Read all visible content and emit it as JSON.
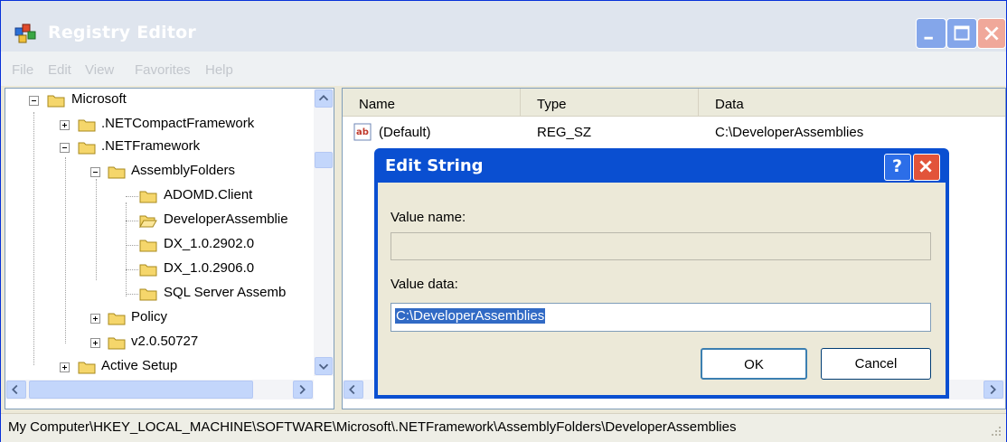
{
  "window": {
    "title": "Registry Editor"
  },
  "menu": [
    "File",
    "Edit",
    "View",
    "Favorites",
    "Help"
  ],
  "tree": [
    {
      "label": "Microsoft",
      "expanded": true
    },
    {
      "label": ".NETCompactFramework",
      "expanded": false
    },
    {
      "label": ".NETFramework",
      "expanded": true
    },
    {
      "label": "AssemblyFolders",
      "expanded": true
    },
    {
      "label": "ADOMD.Client"
    },
    {
      "label": "DeveloperAssemblie",
      "selected": true
    },
    {
      "label": "DX_1.0.2902.0"
    },
    {
      "label": "DX_1.0.2906.0"
    },
    {
      "label": "SQL Server Assemb"
    },
    {
      "label": "Policy",
      "expanded": false
    },
    {
      "label": "v2.0.50727",
      "expanded": false
    },
    {
      "label": "Active Setup",
      "expanded": false
    }
  ],
  "list": {
    "columns": [
      "Name",
      "Type",
      "Data"
    ],
    "rows": [
      {
        "name": "(Default)",
        "type": "REG_SZ",
        "data": "C:\\DeveloperAssemblies"
      }
    ]
  },
  "dialog": {
    "title": "Edit String",
    "value_name_label": "Value name:",
    "value_name": "",
    "value_data_label": "Value data:",
    "value_data": "C:\\DeveloperAssemblies",
    "ok_label": "OK",
    "cancel_label": "Cancel",
    "help_glyph": "?"
  },
  "status": {
    "path": "My Computer\\HKEY_LOCAL_MACHINE\\SOFTWARE\\Microsoft\\.NETFramework\\AssemblyFolders\\DeveloperAssemblies"
  },
  "colors": {
    "title_blue": "#0a4fd1",
    "selection": "#316ac5",
    "face": "#ece9d8"
  }
}
